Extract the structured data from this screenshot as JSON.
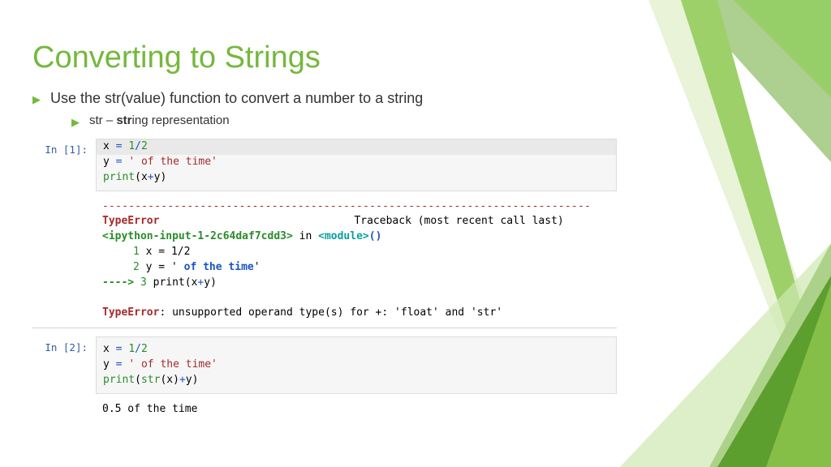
{
  "title": "Converting to Strings",
  "bullets": {
    "main": "Use the str(value) function to convert a number to a string",
    "sub_prefix": "str – ",
    "sub_bold": "str",
    "sub_rest": "ing representation"
  },
  "cell1": {
    "prompt": "In [1]:",
    "code": {
      "l1a": "x ",
      "l1b": "= ",
      "l1c": "1",
      "l1d": "/",
      "l1e": "2",
      "l2a": "y ",
      "l2b": "= ",
      "l2c": "' of the time'",
      "l3a": "print",
      "l3b": "(x",
      "l3c": "+",
      "l3d": "y)"
    },
    "err": {
      "dashes": "---------------------------------------------------------------------------",
      "type": "TypeError",
      "trace": "Traceback (most recent call last)",
      "src1": "<ipython-input-1-2c64daf7cdd3>",
      "inword": " in ",
      "mod": "<module>",
      "parens": "()",
      "ln1n": "1",
      "ln1t": " x = 1/2",
      "ln2n": "2",
      "ln2t": " y = '",
      "ln2bold": " of the time",
      "ln2tail": "'",
      "arrow": "----> ",
      "ln3n": "3",
      "ln3t": " print(x",
      "ln3plus": "+",
      "ln3tail": "y)",
      "msg_label": "TypeError",
      "msg": ": unsupported operand type(s) for +: 'float' and 'str'"
    }
  },
  "cell2": {
    "prompt": "In [2]:",
    "code": {
      "l1a": "x ",
      "l1b": "= ",
      "l1c": "1",
      "l1d": "/",
      "l1e": "2",
      "l2a": "y ",
      "l2b": "= ",
      "l2c": "' of the time'",
      "l3a": "print",
      "l3b": "(",
      "l3c": "str",
      "l3d": "(x)",
      "l3e": "+",
      "l3f": "y)"
    },
    "out": "0.5 of the time"
  }
}
